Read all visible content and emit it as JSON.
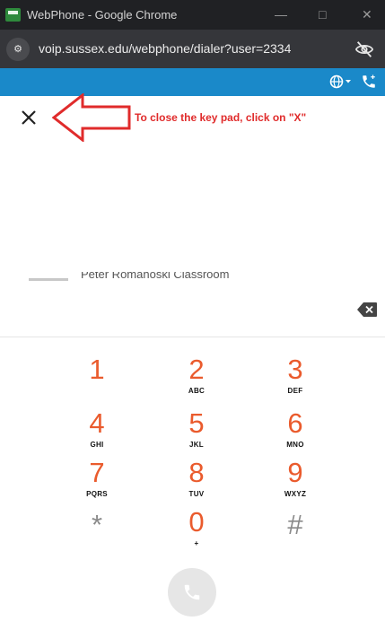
{
  "window": {
    "title": "WebPhone - Google Chrome",
    "min_glyph": "—",
    "max_glyph": "□",
    "close_glyph": "✕"
  },
  "address": {
    "url": "voip.sussex.edu/webphone/dialer?user=2334",
    "site_info_glyph": "⚙"
  },
  "annotation": {
    "text": "To close the key pad, click on \"X\""
  },
  "background": {
    "partial_text": "Peter Romanoski Classroom"
  },
  "dialpad": {
    "keys": [
      {
        "digit": "1",
        "letters": ""
      },
      {
        "digit": "2",
        "letters": "ABC"
      },
      {
        "digit": "3",
        "letters": "DEF"
      },
      {
        "digit": "4",
        "letters": "GHI"
      },
      {
        "digit": "5",
        "letters": "JKL"
      },
      {
        "digit": "6",
        "letters": "MNO"
      },
      {
        "digit": "7",
        "letters": "PQRS"
      },
      {
        "digit": "8",
        "letters": "TUV"
      },
      {
        "digit": "9",
        "letters": "WXYZ"
      },
      {
        "digit": "*",
        "letters": ""
      },
      {
        "digit": "0",
        "letters": "+"
      },
      {
        "digit": "#",
        "letters": ""
      }
    ]
  },
  "colors": {
    "accent_blue": "#1a89c9",
    "digit_orange": "#ea5b2d",
    "annotation_red": "#e02b2b"
  }
}
